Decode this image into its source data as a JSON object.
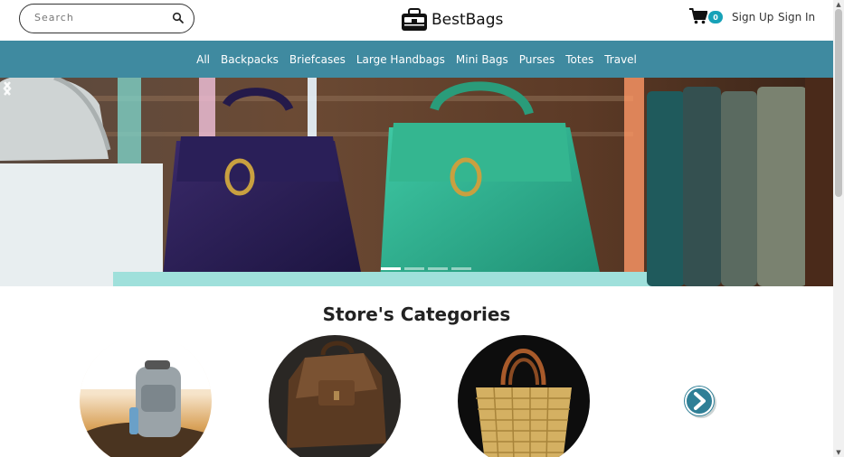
{
  "header": {
    "search_placeholder": "Search",
    "brand_name": "BestBags",
    "cart_count": "0",
    "signup_label": "Sign Up",
    "signin_label": "Sign In"
  },
  "nav": {
    "items": [
      {
        "label": "All"
      },
      {
        "label": "Backpacks"
      },
      {
        "label": "Briefcases"
      },
      {
        "label": "Large Handbags"
      },
      {
        "label": "Mini Bags"
      },
      {
        "label": "Purses"
      },
      {
        "label": "Totes"
      },
      {
        "label": "Travel"
      }
    ]
  },
  "carousel": {
    "active_index": 0,
    "slide_count": 4
  },
  "categories": {
    "title": "Store's Categories"
  },
  "colors": {
    "nav_bg": "#3f8aa0",
    "badge_bg": "#17a2b8",
    "next_button": "#2f7f96"
  },
  "icons": {
    "search": "search-icon",
    "cart": "cart-icon",
    "logo": "bag-logo-icon",
    "prev": "chevron-left-icon",
    "next": "chevron-right-icon",
    "category_next": "arrow-circle-right-icon"
  }
}
